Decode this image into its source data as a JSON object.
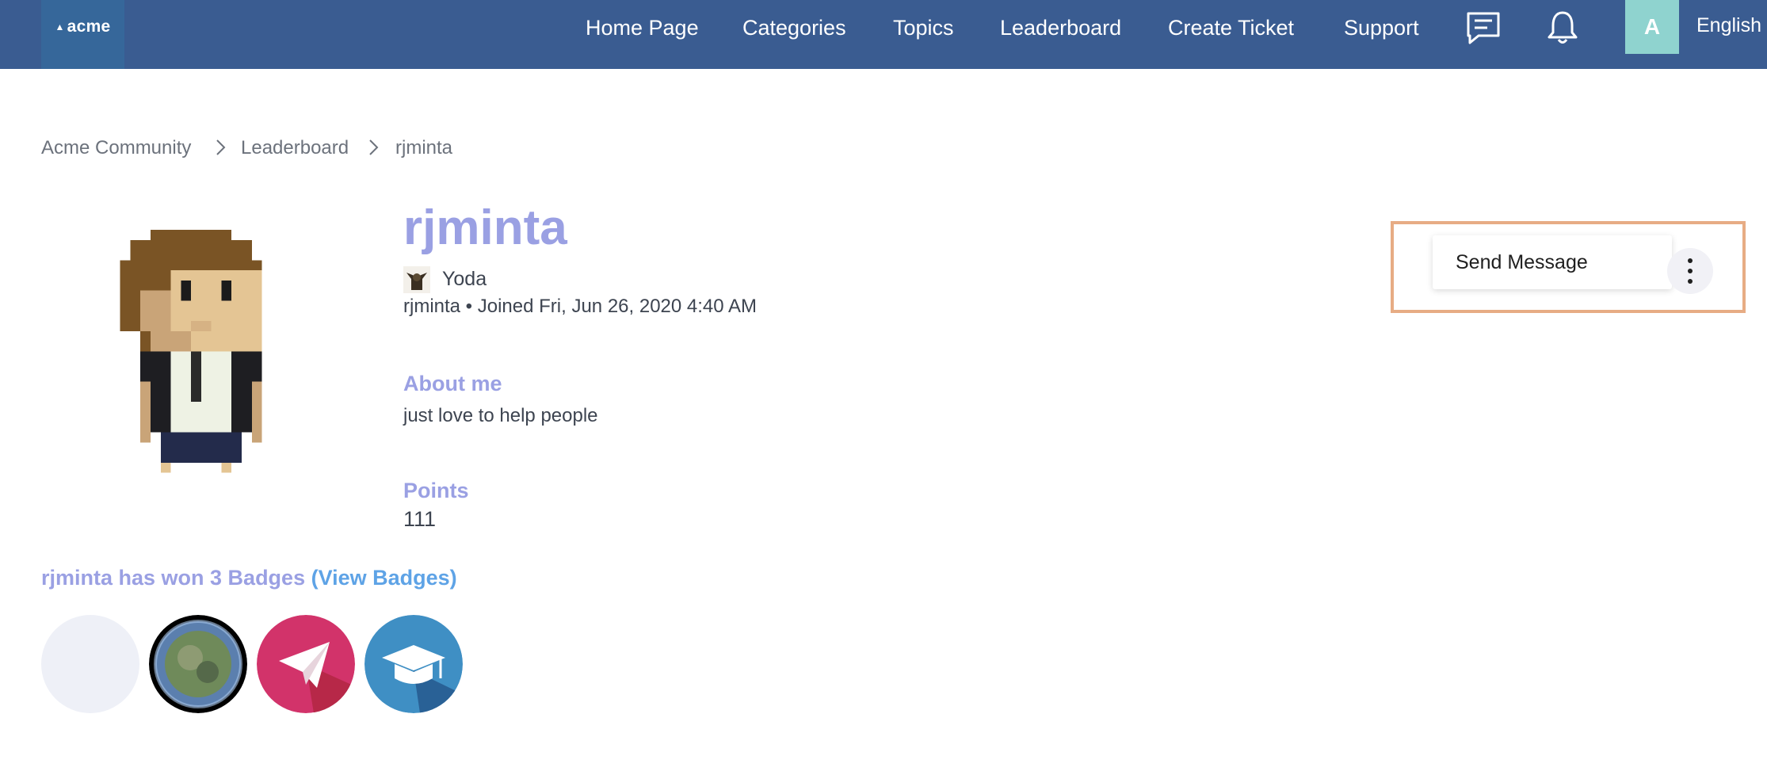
{
  "brand": {
    "logo_text": "acme"
  },
  "nav": {
    "items": [
      "Home Page",
      "Categories",
      "Topics",
      "Leaderboard",
      "Create Ticket",
      "Support"
    ],
    "avatar_initial": "A",
    "language": "English"
  },
  "breadcrumb": [
    "Acme Community",
    "Leaderboard",
    "rjminta"
  ],
  "profile": {
    "username": "rjminta",
    "rank": "Yoda",
    "joined_line": "rjminta • Joined Fri, Jun 26, 2020 4:40 AM",
    "about_heading": "About me",
    "about_text": "just love to help people",
    "points_heading": "Points",
    "points_value": "111"
  },
  "badges": {
    "summary": "rjminta has won 3 Badges",
    "link": "(View Badges)",
    "icons": [
      "empty-badge-icon",
      "earth-badge-icon",
      "paper-plane-badge-icon",
      "graduation-cap-badge-icon"
    ]
  },
  "actions": {
    "send_message": "Send Message"
  },
  "colors": {
    "topbar": "#3a5c91",
    "accent": "#9aa0e3",
    "link": "#5ea3e6",
    "highlight_border": "#e7ac84"
  }
}
